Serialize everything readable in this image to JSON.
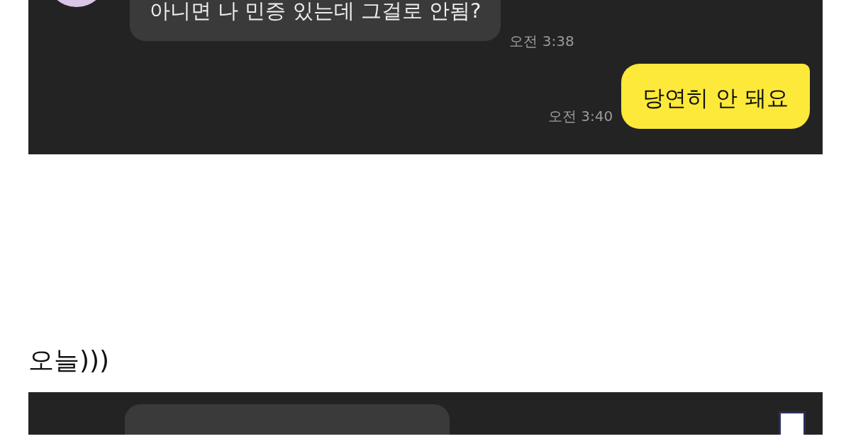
{
  "chat_top": {
    "messages": [
      {
        "kind": "received",
        "text": "아니면 나 민증 있는데 그걸로 안됨?",
        "time": "오전 3:38"
      },
      {
        "kind": "sent",
        "text": "당연히 안 돼요",
        "time": "오전 3:40"
      }
    ]
  },
  "caption": "오늘)))"
}
